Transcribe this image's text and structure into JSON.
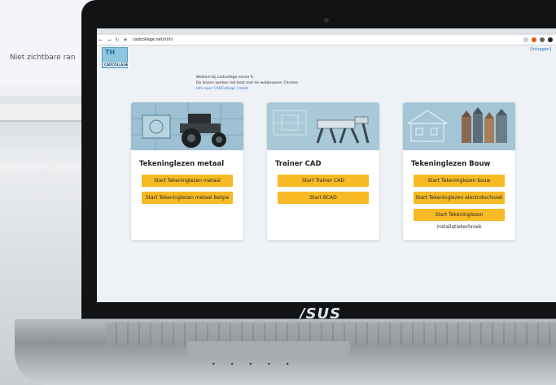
{
  "background": {
    "text": "Niet zichtbare ran"
  },
  "browser": {
    "url": "cadcollege.net/nl/nl"
  },
  "page": {
    "login_link": "[Inloggen]",
    "logo_text": "TH",
    "logo_sub": "CADCOLLEGE",
    "welcome_line1": "Welkom bij cadcollege versie 6.",
    "welcome_line2": "De lessen werken het best met de webbrowser Chrome.",
    "welcome_links": "Info over CADCollege | Inzet",
    "cards": [
      {
        "title": "Tekeninglezen metaal",
        "buttons": [
          "Start Tekeninglezen metaal",
          "Start Tekeninglezen metaal Belgie"
        ]
      },
      {
        "title": "Trainer CAD",
        "buttons": [
          "Start Trainer CAD",
          "Start BCAD"
        ]
      },
      {
        "title": "Tekeninglezen Bouw",
        "buttons": [
          "Start Tekeninglezen bouw",
          "Start Tekeninglezen electrotechniek",
          "Start Tekeninglezen installatietechniek"
        ]
      }
    ]
  },
  "laptop": {
    "brand": "/SUS"
  },
  "colors": {
    "button": "#f7b924",
    "card_image": "#8fb6c9"
  }
}
